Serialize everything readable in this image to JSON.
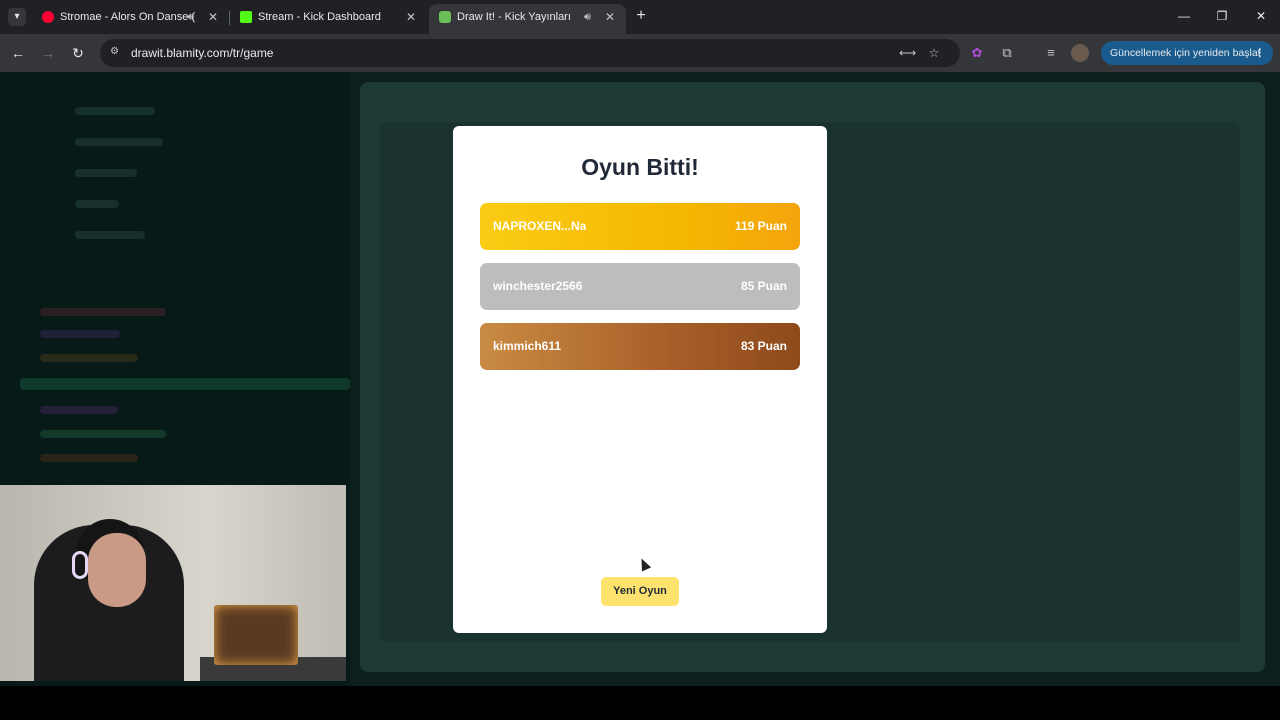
{
  "browser": {
    "tabs": [
      {
        "title": "Stromae - Alors On Danse (",
        "icon": "youtube-icon",
        "icon_color": "#ff0033",
        "audio": true,
        "active": false
      },
      {
        "title": "Stream - Kick Dashboard",
        "icon": "kick-icon",
        "icon_color": "#53fc18",
        "audio": false,
        "active": false
      },
      {
        "title": "Draw It! - Kick Yayınları İçin",
        "icon": "drawit-icon",
        "icon_color": "#6bbf59",
        "audio": true,
        "active": true
      }
    ],
    "new_tab_label": "+",
    "url": "drawit.blamity.com/tr/game",
    "update_label": "Güncellemek için yeniden başlat"
  },
  "modal": {
    "title": "Oyun Bitti!",
    "scores": [
      {
        "name": "NAPROXEN...Na",
        "points": "119 Puan",
        "medal": "gold"
      },
      {
        "name": "winchester2566",
        "points": "85 Puan",
        "medal": "silver"
      },
      {
        "name": "kimmich611",
        "points": "83 Puan",
        "medal": "bronze"
      }
    ],
    "new_game_label": "Yeni Oyun"
  },
  "colors": {
    "gold": "#facc15",
    "silver": "#bdbdbd",
    "bronze": "#a85e28",
    "button": "#fde36d",
    "update_button": "#1a5b8d"
  }
}
